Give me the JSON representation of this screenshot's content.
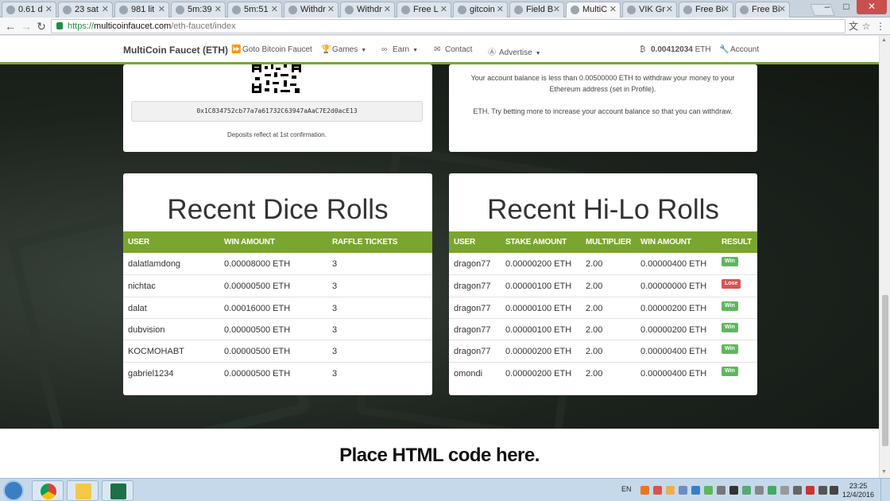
{
  "browser": {
    "tabs": [
      {
        "label": "0.61 d",
        "active": false
      },
      {
        "label": "23 sat",
        "active": false
      },
      {
        "label": "981 lit",
        "active": false
      },
      {
        "label": "5m:39",
        "active": false
      },
      {
        "label": "5m:51",
        "active": false
      },
      {
        "label": "Withdr",
        "active": false
      },
      {
        "label": "Withdr",
        "active": false
      },
      {
        "label": "Free L",
        "active": false
      },
      {
        "label": "gitcoin",
        "active": false
      },
      {
        "label": "Field B",
        "active": false
      },
      {
        "label": "MultiC",
        "active": true
      },
      {
        "label": "VIK Gr",
        "active": false
      },
      {
        "label": "Free Bi",
        "active": false
      },
      {
        "label": "Free Bi",
        "active": false
      }
    ],
    "url_scheme": "https://",
    "url_host": "multicoinfaucet.com",
    "url_path": "/eth-faucet/index"
  },
  "site": {
    "brand": "MultiCoin Faucet (ETH)",
    "nav": [
      {
        "icon": "fast-forward-icon",
        "glyph": "⏩",
        "label": "Goto Bitcoin Faucet",
        "dropdown": false
      },
      {
        "icon": "trophy-icon",
        "glyph": "🏆",
        "label": "Games",
        "dropdown": true
      },
      {
        "icon": "link-icon",
        "glyph": "∞",
        "label": "Earn",
        "dropdown": true
      },
      {
        "icon": "envelope-icon",
        "glyph": "✉",
        "label": "Contact",
        "dropdown": false
      },
      {
        "icon": "advertise-icon",
        "glyph": "Ⓐ",
        "label": "Advertise",
        "dropdown": true
      }
    ],
    "balance_icon": "₿",
    "balance_value": "0.00412034",
    "balance_unit": "ETH",
    "account_label": "Account"
  },
  "deposit": {
    "address": "0x1C834752cb77a7a61732C63947aAaC7E2d0acE13",
    "note": "Deposits reflect at 1st confirmation."
  },
  "withdraw": {
    "message1": "Your account balance is less than 0.00500000 ETH to withdraw your money to your Ethereum address (set in Profile).",
    "message2": "ETH. Try betting more to increase your account balance so that you can withdraw."
  },
  "dice": {
    "title": "Recent Dice Rolls",
    "headers": [
      "USER",
      "WIN AMOUNT",
      "RAFFLE TICKETS"
    ],
    "rows": [
      [
        "dalatlamdong",
        "0.00008000 ETH",
        "3"
      ],
      [
        "nichtac",
        "0.00000500 ETH",
        "3"
      ],
      [
        "dalat",
        "0.00016000 ETH",
        "3"
      ],
      [
        "dubvision",
        "0.00000500 ETH",
        "3"
      ],
      [
        "KOCMOHABT",
        "0.00000500 ETH",
        "3"
      ],
      [
        "gabriel1234",
        "0.00000500 ETH",
        "3"
      ]
    ]
  },
  "hilo": {
    "title": "Recent Hi-Lo Rolls",
    "headers": [
      "USER",
      "STAKE AMOUNT",
      "MULTIPLIER",
      "WIN AMOUNT",
      "RESULT"
    ],
    "rows": [
      [
        "dragon77",
        "0.00000200 ETH",
        "2.00",
        "0.00000400 ETH",
        "Win"
      ],
      [
        "dragon77",
        "0.00000100 ETH",
        "2.00",
        "0.00000000 ETH",
        "Lose"
      ],
      [
        "dragon77",
        "0.00000100 ETH",
        "2.00",
        "0.00000200 ETH",
        "Win"
      ],
      [
        "dragon77",
        "0.00000100 ETH",
        "2.00",
        "0.00000200 ETH",
        "Win"
      ],
      [
        "dragon77",
        "0.00000200 ETH",
        "2.00",
        "0.00000400 ETH",
        "Win"
      ],
      [
        "omondi",
        "0.00000200 ETH",
        "2.00",
        "0.00000400 ETH",
        "Win"
      ]
    ]
  },
  "colors": {
    "accent": "#7aa52f",
    "win": "#5cb85c",
    "lose": "#d9534f"
  },
  "footer_text": "Place HTML code here.",
  "taskbar": {
    "lang": "EN",
    "time": "23:25",
    "date": "12/4/2016"
  }
}
